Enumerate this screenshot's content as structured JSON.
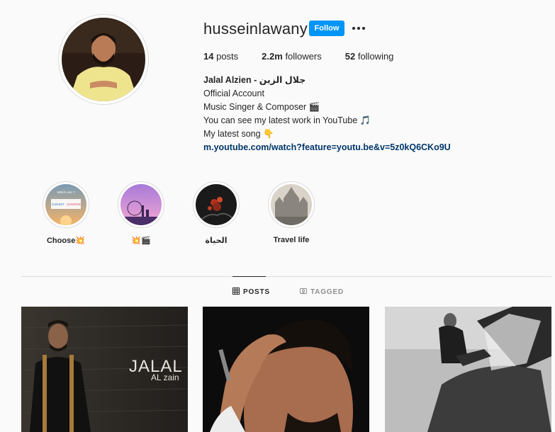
{
  "profile": {
    "username": "husseinlawany",
    "follow_label": "Follow",
    "posts_count": "14",
    "posts_label": "posts",
    "followers_count": "2.2m",
    "followers_label": "followers",
    "following_count": "52",
    "following_label": "following",
    "bio": {
      "name": "Jalal Alzien - جلال الزين",
      "line1": "Official Account",
      "line2": "Music Singer & Composer 🎬",
      "line3": "You can see my latest work in YouTube 🎵",
      "line4": "My latest song 👇",
      "link": "m.youtube.com/watch?feature=youtu.be&v=5z0kQ6CKo9U"
    }
  },
  "highlights": [
    {
      "label": "Choose💥",
      "thumb_text_1": "Which one ?",
      "thumb_text_2": "SUNSET",
      "thumb_text_3": "SUNRISE"
    },
    {
      "label": "💥🎬"
    },
    {
      "label": "الحياة"
    },
    {
      "label": "Travel life"
    }
  ],
  "tabs": {
    "posts": "POSTS",
    "tagged": "TAGGED"
  },
  "posts": [
    {
      "overlay_title": "JALAL",
      "overlay_subtitle": "AL zain"
    },
    {},
    {}
  ],
  "colors": {
    "accent": "#0095f6",
    "link": "#00376b",
    "background": "#fafafa",
    "border": "#dbdbdb",
    "muted": "#8e8e8e"
  }
}
